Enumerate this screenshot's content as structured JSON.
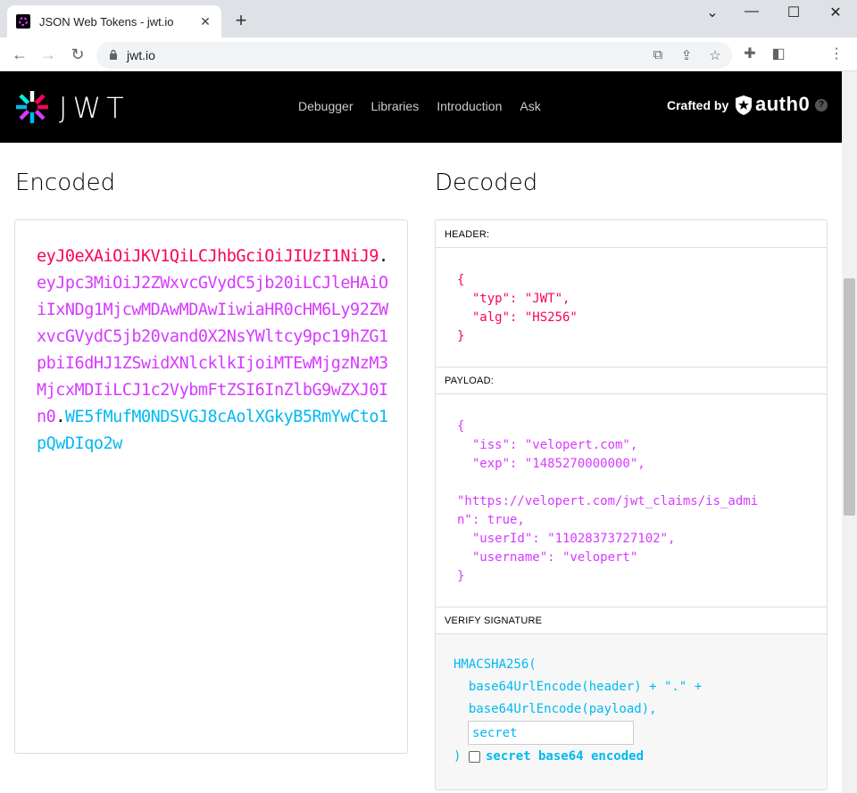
{
  "browser": {
    "tab_title": "JSON Web Tokens - jwt.io",
    "tab_close": "✕",
    "new_tab": "+",
    "url": "jwt.io",
    "window_controls": {
      "minimize": "—",
      "maximize": "☐",
      "close": "✕",
      "tabs_menu": "⌄"
    }
  },
  "header": {
    "logo_text": "JWT",
    "nav": [
      "Debugger",
      "Libraries",
      "Introduction",
      "Ask"
    ],
    "crafted_by": "Crafted by",
    "brand": "auth0",
    "help": "?"
  },
  "encoded": {
    "title": "Encoded",
    "token_header": "eyJ0eXAiOiJKV1QiLCJhbGciOiJIUzI1NiJ9",
    "token_payload": "eyJpc3MiOiJ2ZWxvcGVydC5jb20iLCJleHAiOiIxNDg1MjcwMDAwMDAwIiwiaHR0cHM6Ly92ZWxvcGVydC5jb20vand0X2NsYWltcy9pc19hZG1pbiI6dHJ1ZSwidXNlcklkIjoiMTEwMjgzNzM3MjcxMDIiLCJ1c2VybmFtZSI6InZlbG9wZXJ0In0",
    "token_signature": "WE5fMufM0NDSVGJ8cAolXGkyB5RmYwCto1pQwDIqo2w",
    "dot": "."
  },
  "decoded": {
    "title": "Decoded",
    "header_label": "HEADER:",
    "header_json": "{\n  \"typ\": \"JWT\",\n  \"alg\": \"HS256\"\n}",
    "payload_label": "PAYLOAD:",
    "payload_json": "{\n  \"iss\": \"velopert.com\",\n  \"exp\": \"1485270000000\",\n\n\"https://velopert.com/jwt_claims/is_admi\nn\": true,\n  \"userId\": \"11028373727102\",\n  \"username\": \"velopert\"\n}",
    "verify_label": "VERIFY SIGNATURE",
    "verify_line1": "HMACSHA256(",
    "verify_line2": "  base64UrlEncode(header) + \".\" +",
    "verify_line3": "  base64UrlEncode(payload),",
    "secret_value": "secret",
    "close_paren": ")",
    "b64_label": "secret base64 encoded",
    "b64_checked": false
  },
  "colors": {
    "header": "#fb015b",
    "payload": "#d63aff",
    "signature": "#00b9f1"
  }
}
